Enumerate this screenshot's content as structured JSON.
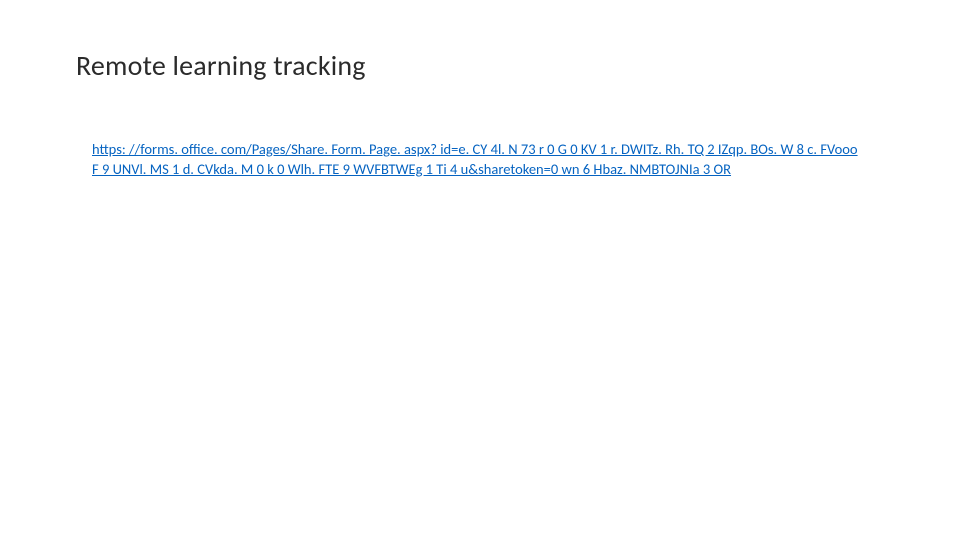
{
  "title": "Remote learning tracking",
  "link": {
    "display_line1": "https: //forms. office. com/Pages/Share. Form. Page. aspx? id=e. CY 4l. N 73 r 0 G 0 KV 1 r. DWITz. Rh. TQ 2 IZqp. BOs. W 8 c. FVooo",
    "display_line2": " F 9 UNVl. MS 1 d. CVkda. M 0 k 0 Wlh. FTE 9 WVFBTWEg 1 Ti 4 u&sharetoken=0 wn 6 Hbaz. NMBTOJNIa 3 OR"
  }
}
